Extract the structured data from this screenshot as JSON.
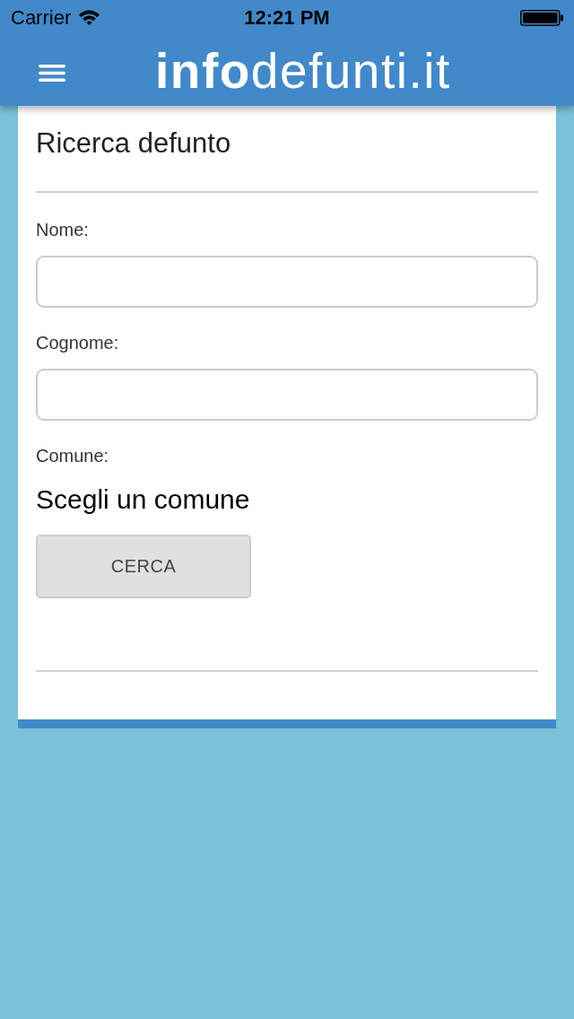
{
  "status_bar": {
    "carrier": "Carrier",
    "time": "12:21 PM"
  },
  "header": {
    "logo": "**info**defunti.it"
  },
  "form": {
    "title": "Ricerca defunto",
    "fields": [
      {
        "kind": "text",
        "label": "Nome:"
      },
      {
        "kind": "text",
        "label": "Cognome:"
      },
      {
        "kind": "select",
        "label": "Comune:",
        "value": "Scegli un comune"
      }
    ],
    "button": "CERCA"
  }
}
